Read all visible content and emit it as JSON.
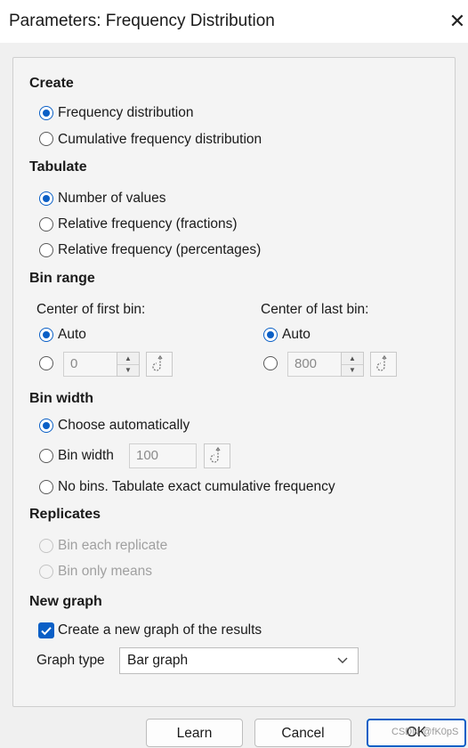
{
  "window": {
    "title": "Parameters: Frequency Distribution",
    "close_glyph": "✕"
  },
  "create": {
    "heading": "Create",
    "options": [
      {
        "label": "Frequency distribution",
        "selected": true
      },
      {
        "label": "Cumulative frequency distribution",
        "selected": false
      }
    ]
  },
  "tabulate": {
    "heading": "Tabulate",
    "options": [
      {
        "label": "Number of values",
        "selected": true
      },
      {
        "label": "Relative frequency (fractions)",
        "selected": false
      },
      {
        "label": "Relative frequency (percentages)",
        "selected": false
      }
    ]
  },
  "bin_range": {
    "heading": "Bin range",
    "first": {
      "label": "Center of first bin:",
      "auto_label": "Auto",
      "auto_selected": true,
      "value": "0"
    },
    "last": {
      "label": "Center of last bin:",
      "auto_label": "Auto",
      "auto_selected": true,
      "value": "800"
    }
  },
  "bin_width": {
    "heading": "Bin width",
    "auto_label": "Choose automatically",
    "auto_selected": true,
    "width_label": "Bin width",
    "width_value": "100",
    "no_bins_label": "No bins. Tabulate exact cumulative frequency"
  },
  "replicates": {
    "heading": "Replicates",
    "options": [
      {
        "label": "Bin each replicate",
        "enabled": false
      },
      {
        "label": "Bin only means",
        "enabled": false
      }
    ]
  },
  "new_graph": {
    "heading": "New graph",
    "create_label": "Create a new graph of the results",
    "create_checked": true,
    "graph_type_label": "Graph type",
    "graph_type_value": "Bar graph"
  },
  "buttons": {
    "learn": "Learn",
    "cancel": "Cancel",
    "ok": "OK"
  },
  "watermark": "CSDN @fK0pS",
  "colors": {
    "accent": "#0a5fc6"
  },
  "icons": {
    "link_hook": "hook-icon",
    "spin": "spinner-arrows-icon"
  }
}
